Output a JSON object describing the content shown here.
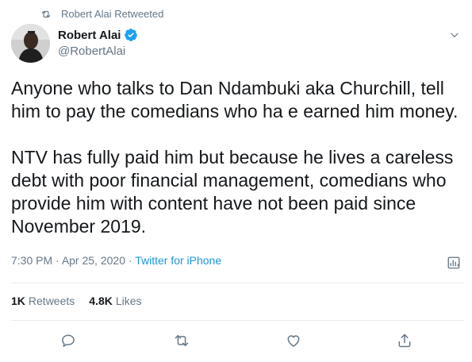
{
  "retweet_context": {
    "text": "Robert Alai Retweeted"
  },
  "author": {
    "display_name": "Robert Alai",
    "handle": "@RobertAlai",
    "verified": true
  },
  "tweet": {
    "paragraphs": [
      "Anyone who talks to Dan Ndambuki aka Churchill, tell him to pay the comedians who ha e earned him money.",
      "NTV has fully paid him but because he lives a careless debt with poor financial management, comedians who provide him with content have not been paid since November 2019."
    ]
  },
  "meta": {
    "time": "7:30 PM",
    "date": "Apr 25, 2020",
    "separator": " · ",
    "source": "Twitter for iPhone"
  },
  "stats": {
    "retweets_count": "1K",
    "retweets_label": "Retweets",
    "likes_count": "4.8K",
    "likes_label": "Likes"
  },
  "colors": {
    "text_primary": "#14171a",
    "text_secondary": "#657786",
    "link": "#1b95e0",
    "verified": "#1da1f2",
    "divider": "#e6ecf0"
  },
  "icons": {
    "retweet_context": "retweet-icon",
    "verified": "verified-badge-icon",
    "more": "chevron-down-icon",
    "analytics": "analytics-icon",
    "reply": "reply-icon",
    "retweet": "retweet-icon",
    "like": "heart-icon",
    "share": "share-icon"
  }
}
